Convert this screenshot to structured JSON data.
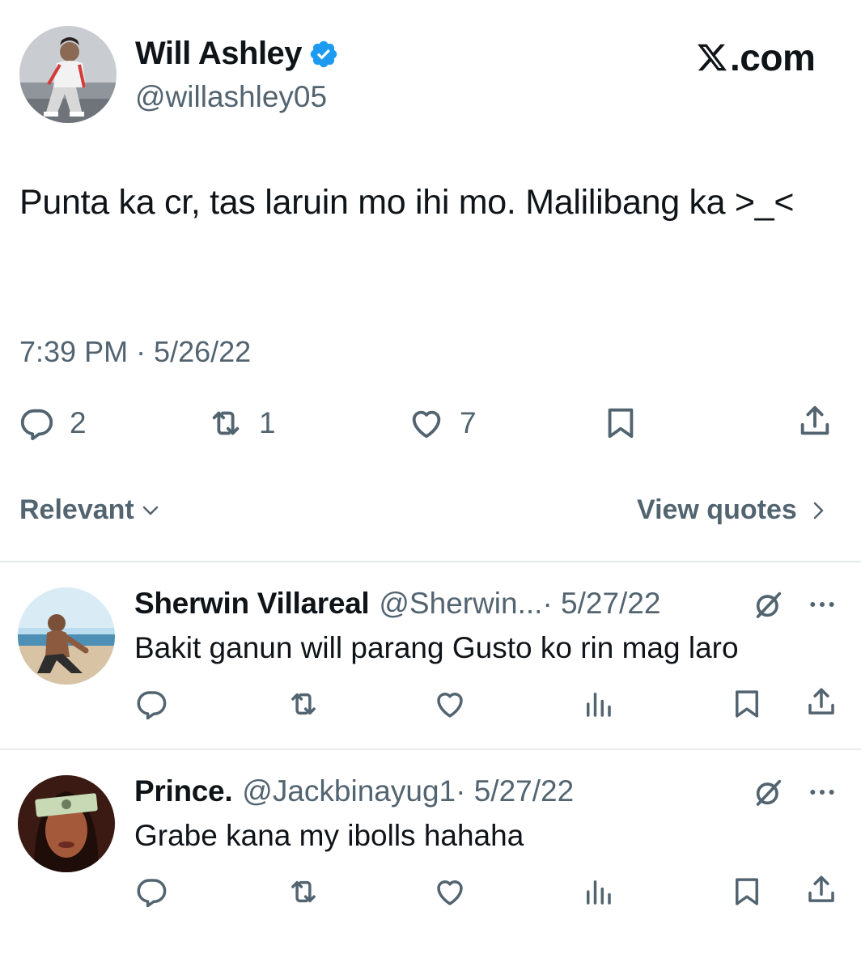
{
  "tweet": {
    "author_name": "Will Ashley",
    "author_handle": "@willashley05",
    "brand": ".com",
    "text": "Punta ka cr, tas laruin mo ihi mo. Malilibang ka >_<",
    "timestamp": "7:39 PM · 5/26/22",
    "stats": {
      "replies": "2",
      "reposts": "1",
      "likes": "7"
    }
  },
  "filter": {
    "sort_label": "Relevant",
    "quotes_label": "View quotes"
  },
  "replies": [
    {
      "name": "Sherwin Villareal",
      "handle": "@Sherwin...",
      "date": "· 5/27/22",
      "text": "Bakit ganun will parang Gusto ko rin mag laro"
    },
    {
      "name": "Prince.",
      "handle": "@Jackbinayug1",
      "date": "· 5/27/22",
      "text": "Grabe kana my ibolls hahaha"
    }
  ],
  "colors": {
    "text": "#0f1419",
    "secondary": "#536471",
    "verified": "#1d9bf0",
    "divider": "#e6e8ea"
  },
  "icons": [
    "verified-badge-icon",
    "x-logo-icon",
    "reply-icon",
    "repost-icon",
    "like-icon",
    "bookmark-icon",
    "share-icon",
    "chevron-down-icon",
    "chevron-right-icon",
    "grok-icon",
    "more-icon",
    "views-icon"
  ]
}
